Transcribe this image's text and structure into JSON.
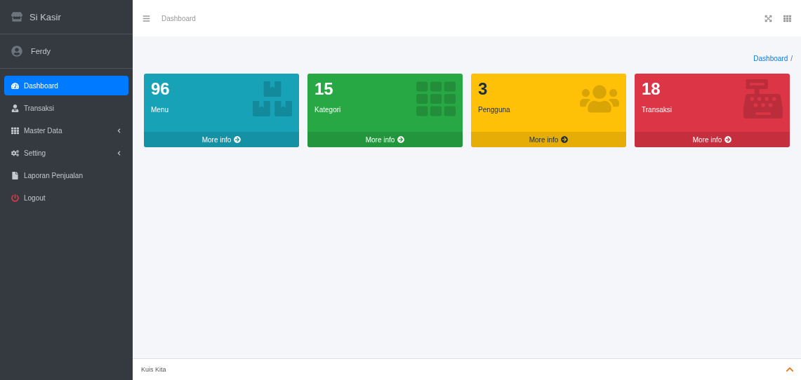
{
  "brand": {
    "title": "Si Kasir"
  },
  "user": {
    "name": "Ferdy"
  },
  "sidebar": {
    "items": [
      {
        "label": "Dashboard",
        "selected": true
      },
      {
        "label": "Transaksi",
        "selected": false
      },
      {
        "label": "Master Data",
        "selected": false,
        "expanded": false
      },
      {
        "label": "Setting",
        "selected": false,
        "expanded": false
      },
      {
        "label": "Laporan Penjualan",
        "selected": false
      },
      {
        "label": "Logout",
        "selected": false
      }
    ]
  },
  "header": {
    "title": "Dashboard"
  },
  "breadcrumb": {
    "items": [
      "Dashboard"
    ],
    "separator": "/"
  },
  "cards": [
    {
      "value": "96",
      "label": "Menu",
      "link": "More info",
      "color": "#17a2b8"
    },
    {
      "value": "15",
      "label": "Kategori",
      "link": "More info",
      "color": "#28a745"
    },
    {
      "value": "3",
      "label": "Pengguna",
      "link": "More info",
      "color": "#ffc107"
    },
    {
      "value": "18",
      "label": "Transaksi",
      "link": "More info",
      "color": "#dc3545"
    }
  ],
  "footer": {
    "text": "Kuis Kita"
  }
}
